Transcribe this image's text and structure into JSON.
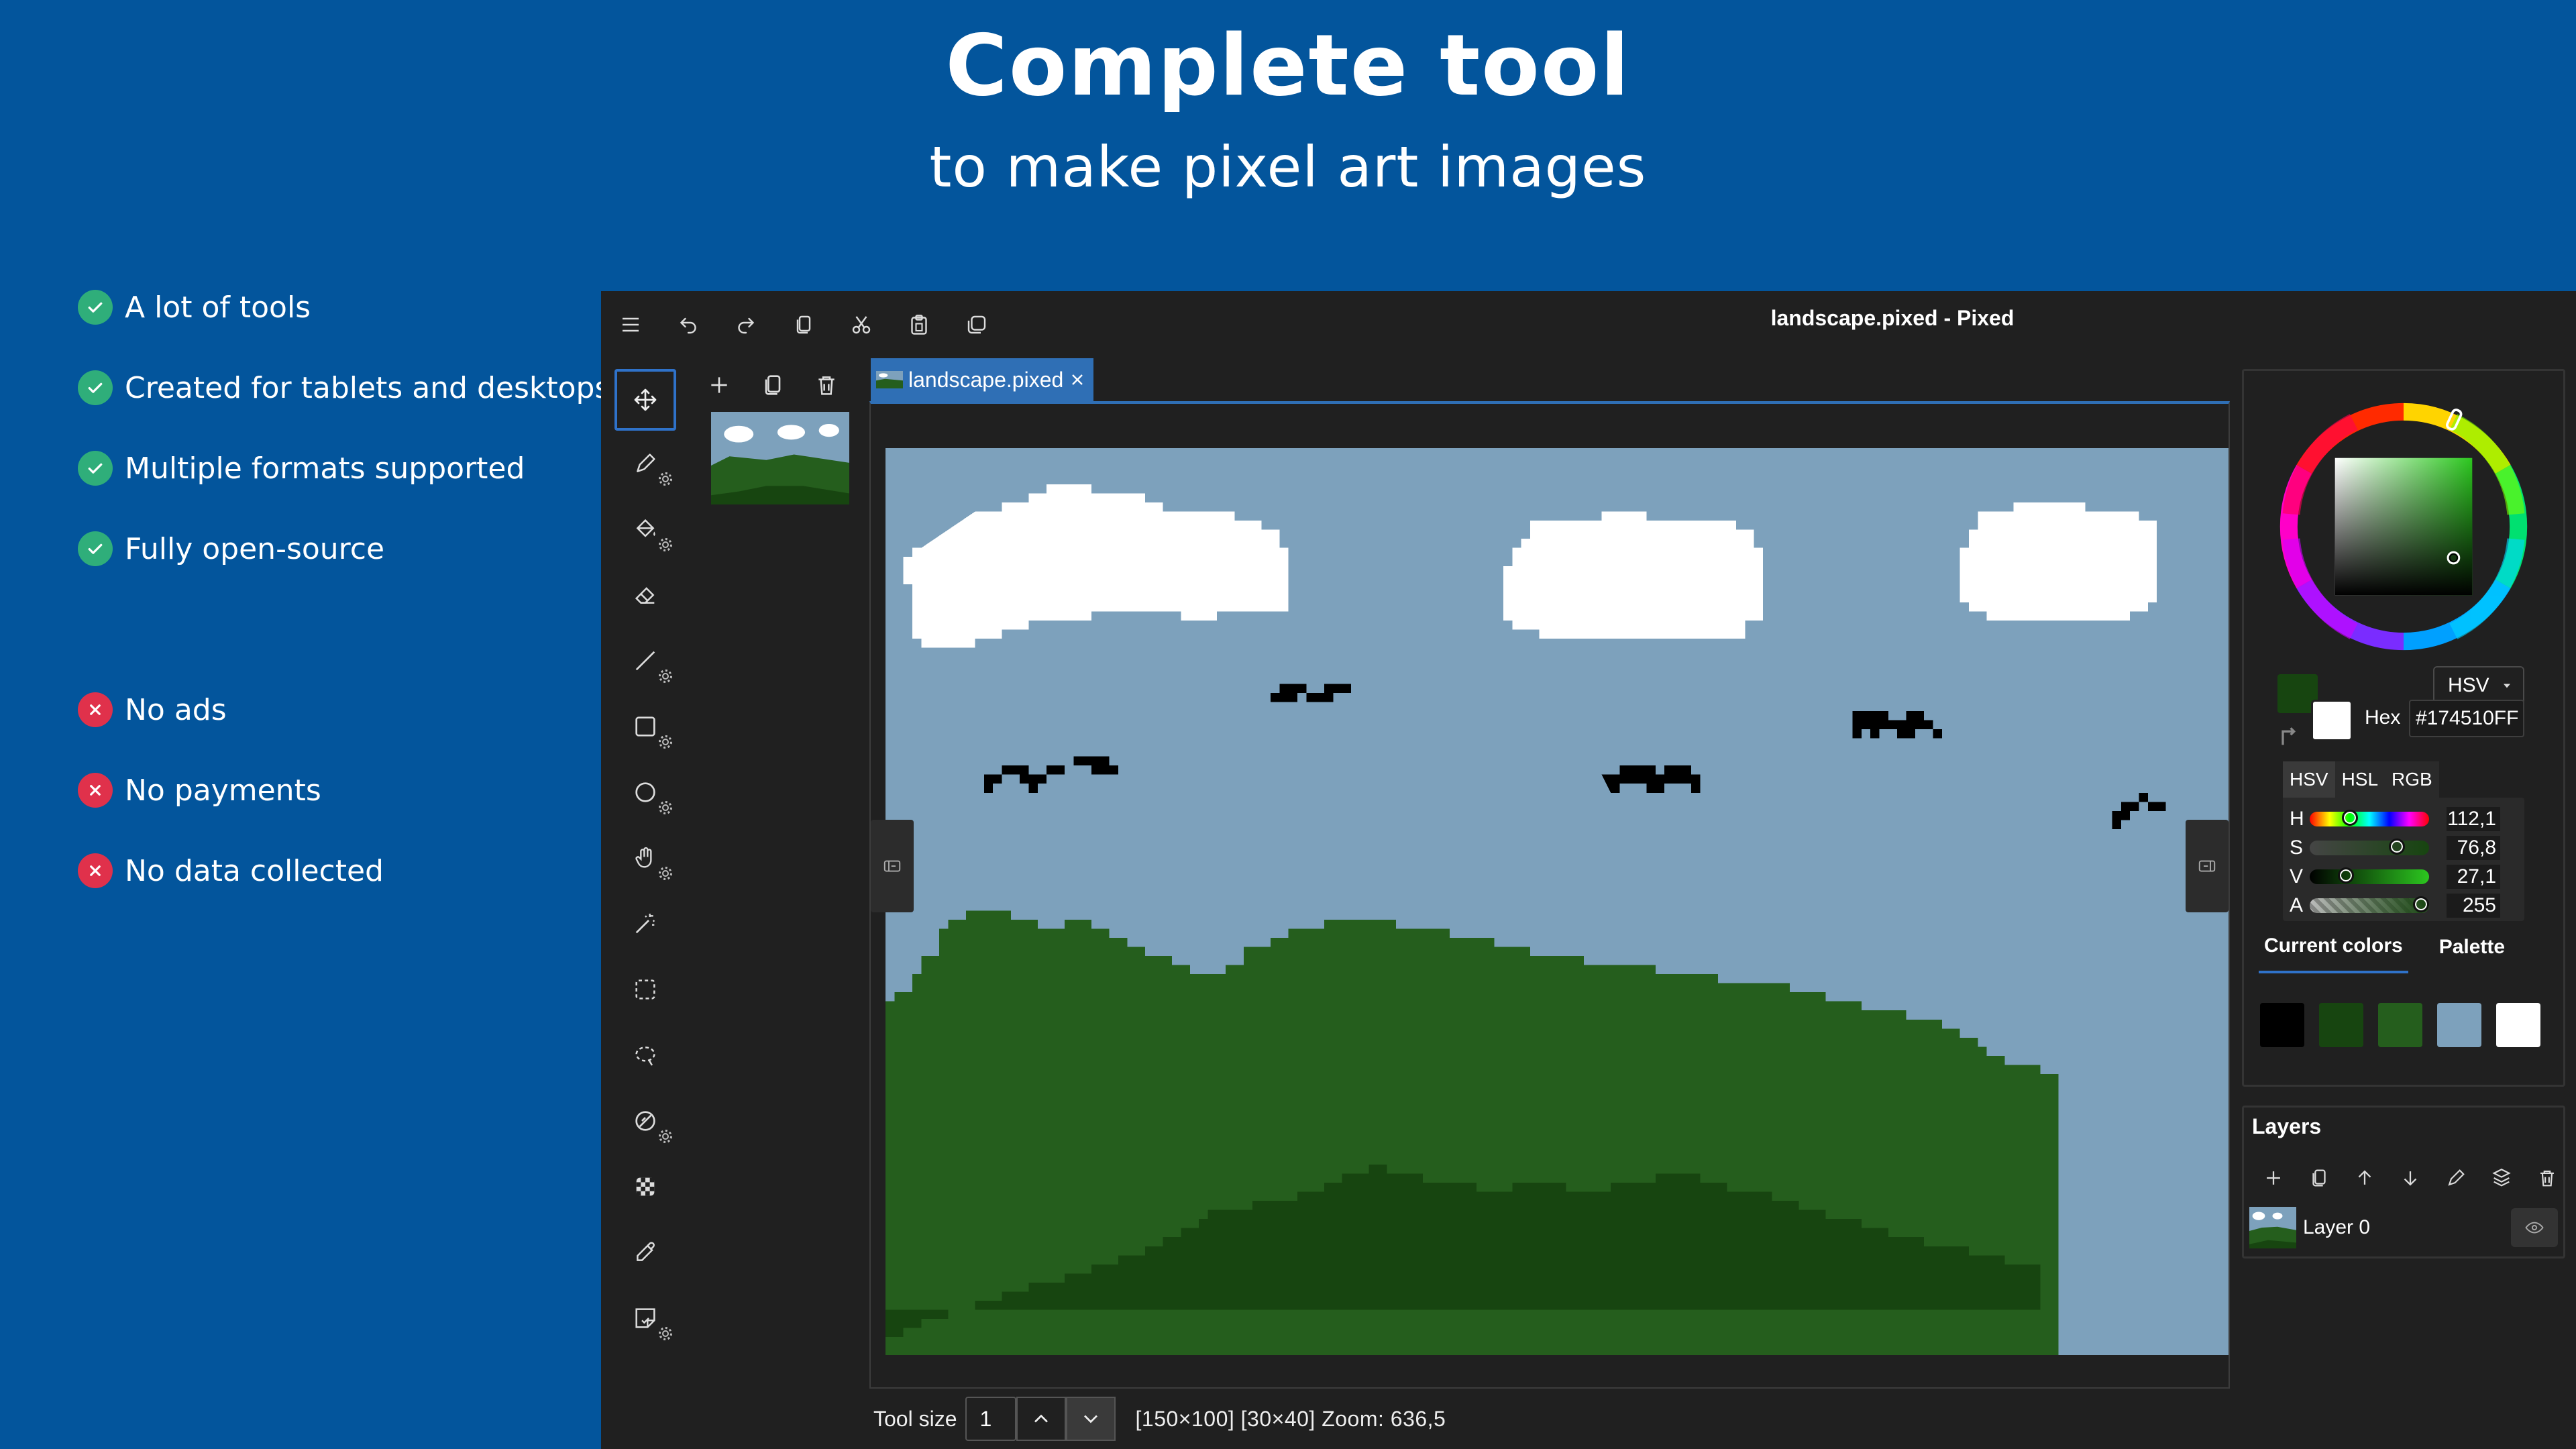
{
  "hero": {
    "title": "Complete tool",
    "subtitle": "to make pixel art images"
  },
  "features": {
    "positives": [
      {
        "label": "A lot of tools",
        "icon": "check-icon"
      },
      {
        "label": "Created for tablets and desktops",
        "icon": "check-icon"
      },
      {
        "label": "Multiple formats supported",
        "icon": "check-icon"
      },
      {
        "label": "Fully open-source",
        "icon": "check-icon"
      }
    ],
    "negatives": [
      {
        "label": "No ads",
        "icon": "cross-icon"
      },
      {
        "label": "No payments",
        "icon": "cross-icon"
      },
      {
        "label": "No data collected",
        "icon": "cross-icon"
      }
    ]
  },
  "app": {
    "window_title": "landscape.pixed - Pixed",
    "titlebar_buttons": [
      "menu-icon",
      "undo-icon",
      "redo-icon",
      "copy-icon",
      "cut-icon",
      "paste-icon",
      "duplicate-icon"
    ],
    "tools": [
      "move-icon",
      "pencil-icon",
      "fill-bucket-icon",
      "eraser-icon",
      "line-icon",
      "rectangle-icon",
      "ellipse-icon",
      "hand-icon",
      "magic-wand-icon",
      "rect-select-icon",
      "lasso-select-icon",
      "disable-icon",
      "checker-icon",
      "eyedropper-icon",
      "sticky-note-icon"
    ],
    "active_tool": "move-icon",
    "frames_buttons": [
      "add-icon",
      "copy-icon",
      "trash-icon"
    ],
    "tab": {
      "label": "landscape.pixed"
    },
    "status": {
      "tool_size_label": "Tool size",
      "tool_size_value": "1",
      "info": "[150×100]  [30×40]  Zoom: 636,5"
    },
    "color": {
      "mode_select": "HSV",
      "hex_label": "Hex",
      "hex_value": "#174510FF",
      "primary": "#174510",
      "secondary": "#ffffff",
      "model_tabs": [
        "HSV",
        "HSL",
        "RGB"
      ],
      "active_model": "HSV",
      "sliders": [
        {
          "label": "H",
          "value": "112,1",
          "level": 0.311
        },
        {
          "label": "S",
          "value": "76,8",
          "level": 0.768
        },
        {
          "label": "V",
          "value": "27,1",
          "level": 0.271
        },
        {
          "label": "A",
          "value": "255",
          "level": 1.0
        }
      ],
      "tabs": [
        "Current colors",
        "Palette"
      ],
      "active_tab": "Current colors",
      "current_colors": [
        "#000000",
        "#174510",
        "#255e1d",
        "#7da1bc",
        "#ffffff"
      ]
    },
    "layers": {
      "title": "Layers",
      "buttons": [
        "add-icon",
        "copy-icon",
        "arrow-up-icon",
        "arrow-down-icon",
        "pencil-icon",
        "merge-icon",
        "trash-icon"
      ],
      "items": [
        {
          "name": "Layer 0"
        }
      ]
    },
    "canvas_colors": {
      "sky": "#7da1bc",
      "cloud": "#ffffff",
      "bird": "#000000",
      "hill_light": "#255e1d",
      "hill_dark": "#174510"
    },
    "accent": "#2f72c9"
  }
}
